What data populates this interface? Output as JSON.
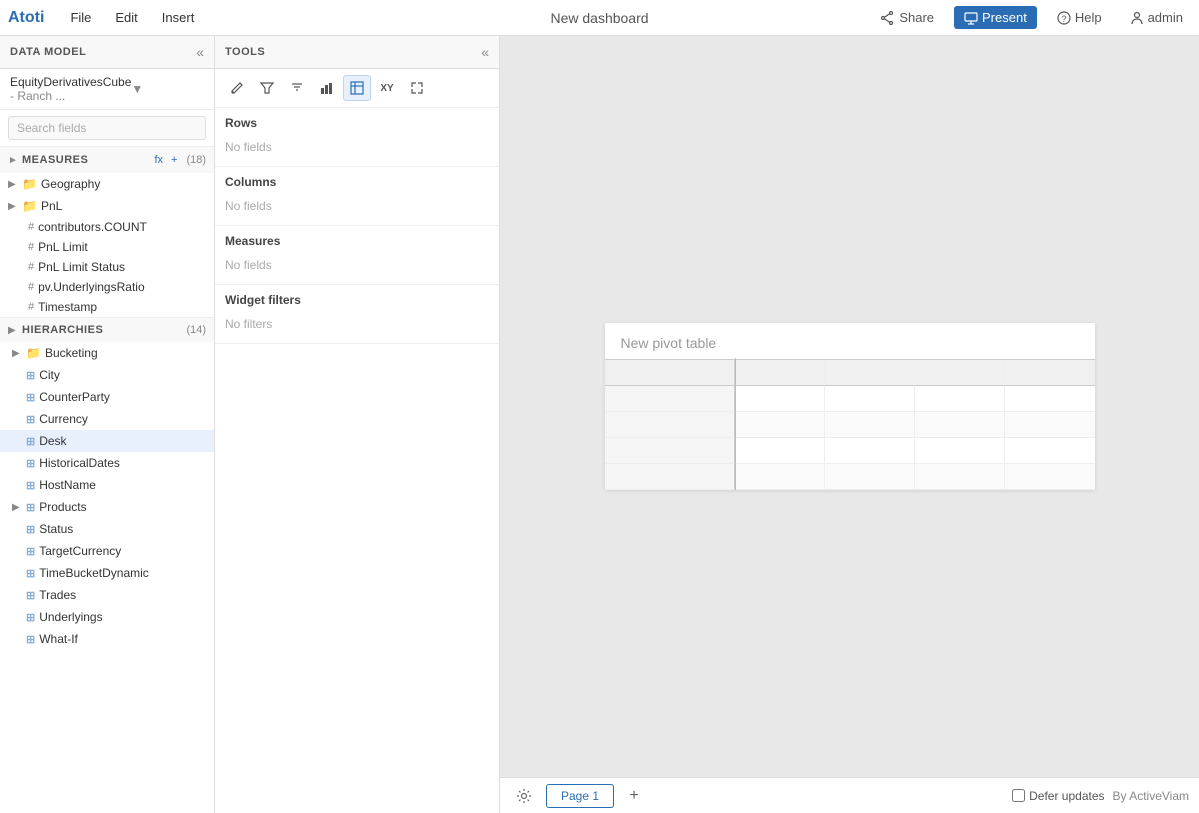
{
  "app": {
    "name": "Atoti"
  },
  "menu": {
    "items": [
      "File",
      "Edit",
      "Insert"
    ]
  },
  "header": {
    "title": "New dashboard",
    "share_label": "Share",
    "present_label": "Present",
    "help_label": "Help",
    "user_label": "admin"
  },
  "data_model": {
    "panel_title": "DATA MODEL",
    "cube_name": "EquityDerivativesCube",
    "cube_suffix": "- Ranch ...",
    "search_placeholder": "Search fields"
  },
  "measures": {
    "section_label": "MEASURES",
    "fx_label": "fx",
    "plus_label": "+",
    "count": "(18)",
    "groups": [
      {
        "label": "Geography",
        "items": []
      },
      {
        "label": "PnL",
        "items": []
      }
    ],
    "items": [
      {
        "label": "contributors.COUNT"
      },
      {
        "label": "PnL Limit"
      },
      {
        "label": "PnL Limit Status"
      },
      {
        "label": "pv.UnderlyingsRatio"
      },
      {
        "label": "Timestamp"
      }
    ]
  },
  "hierarchies": {
    "section_label": "HIERARCHIES",
    "count": "(14)",
    "items": [
      {
        "label": "Bucketing",
        "has_arrow": true
      },
      {
        "label": "City",
        "has_arrow": false
      },
      {
        "label": "CounterParty",
        "has_arrow": false
      },
      {
        "label": "Currency",
        "has_arrow": false
      },
      {
        "label": "Desk",
        "has_arrow": false,
        "hovered": true
      },
      {
        "label": "HistoricalDates",
        "has_arrow": false
      },
      {
        "label": "HostName",
        "has_arrow": false
      },
      {
        "label": "Products",
        "has_arrow": true
      },
      {
        "label": "Status",
        "has_arrow": false
      },
      {
        "label": "TargetCurrency",
        "has_arrow": false
      },
      {
        "label": "TimeBucketDynamic",
        "has_arrow": false
      },
      {
        "label": "Trades",
        "has_arrow": false
      },
      {
        "label": "Underlyings",
        "has_arrow": false
      },
      {
        "label": "What-If",
        "has_arrow": false
      }
    ]
  },
  "tools": {
    "panel_title": "TOOLS",
    "toolbar_icons": [
      "edit",
      "filter",
      "filter-alt",
      "bar-chart",
      "table",
      "xy",
      "expand"
    ],
    "rows": {
      "label": "Rows",
      "empty_text": "No fields"
    },
    "columns": {
      "label": "Columns",
      "empty_text": "No fields"
    },
    "measures_zone": {
      "label": "Measures",
      "empty_text": "No fields"
    },
    "widget_filters": {
      "label": "Widget filters",
      "empty_text": "No filters"
    }
  },
  "canvas": {
    "pivot_title": "New pivot table"
  },
  "footer": {
    "page_label": "Page 1",
    "add_page_label": "+",
    "defer_updates_label": "Defer updates",
    "by_label": "By ActiveViam"
  }
}
